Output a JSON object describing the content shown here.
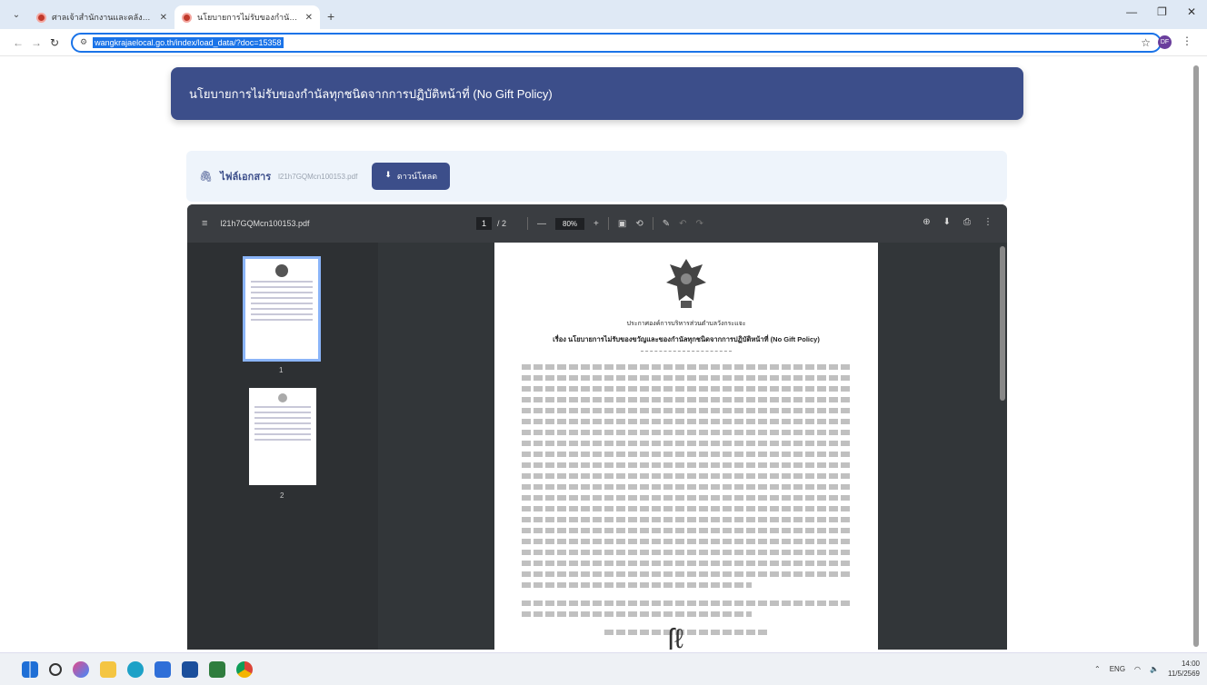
{
  "browser": {
    "tabs": [
      {
        "title": "ศาลเจ้าสำนักงานและคลังข้อมูล"
      },
      {
        "title": "นโยบายการไม่รับของกำนัลทุกชนิดจาก..."
      }
    ],
    "new_tab": "+",
    "url": "wangkrajaelocal.go.th/index/load_data/?doc=15358",
    "profile_initials": "DF"
  },
  "page": {
    "banner_title": "นโยบายการไม่รับของกำนัลทุกชนิดจากการปฏิบัติหน้าที่ (No Gift Policy)",
    "attachment_label": "ไฟล์เอกสาร",
    "attachment_file": "l21h7GQMcn100153.pdf",
    "download_label": "ดาวน์โหลด"
  },
  "pdf": {
    "file_name": "l21h7GQMcn100153.pdf",
    "current_page": "1",
    "total_pages": "/ 2",
    "zoom": "80%",
    "thumbnails": [
      {
        "label": "1"
      },
      {
        "label": "2"
      }
    ],
    "announce_heading": "ประกาศองค์การบริหารส่วนตำบลวังกระแจะ",
    "subject": "เรื่อง นโยบายการไม่รับของขวัญและของกำนัลทุกชนิดจากการปฏิบัติหน้าที่ (No Gift Policy)"
  },
  "taskbar": {
    "lang": "ENG",
    "time": "14:00",
    "date": "11/5/2569"
  },
  "colors": {
    "banner": "#3c4e8a",
    "url_highlight": "#1a73e8"
  },
  "icons": [
    "search-icon",
    "windows-icon",
    "bookmark-star-icon",
    "download-icon",
    "print-icon",
    "rotate-icon"
  ]
}
